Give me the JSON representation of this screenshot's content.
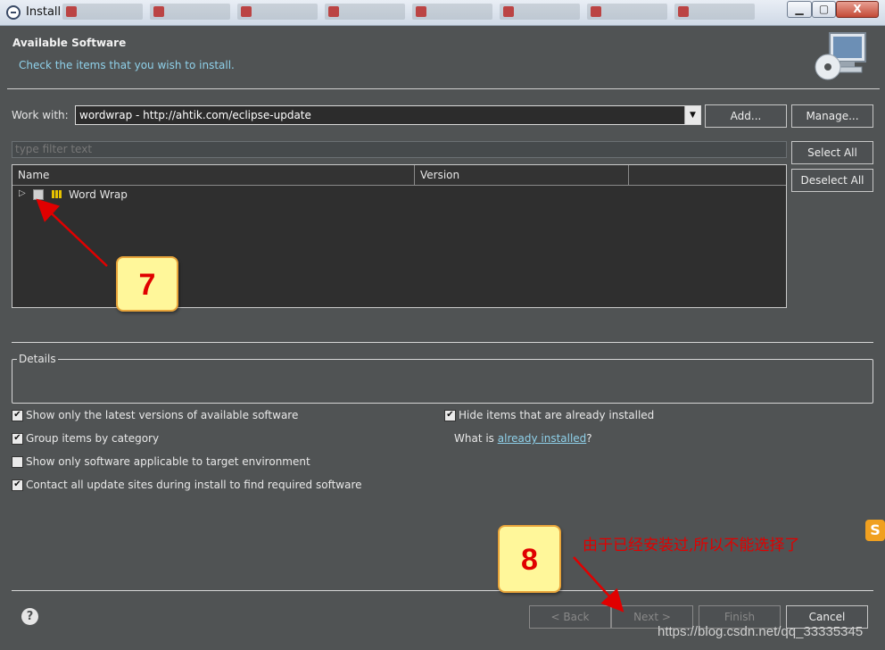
{
  "window": {
    "title": "Install",
    "min_label": "▁",
    "max_label": "▢",
    "close_label": "X"
  },
  "header": {
    "title": "Available Software",
    "description": "Check the items that you wish to install."
  },
  "work_with": {
    "label": "Work with:",
    "value": "wordwrap - http://ahtik.com/eclipse-update",
    "arrow": "▼",
    "add_label": "Add...",
    "manage_label": "Manage..."
  },
  "filter": {
    "placeholder": "type filter text"
  },
  "selection": {
    "select_all": "Select All",
    "deselect_all": "Deselect All"
  },
  "tree": {
    "columns": [
      "Name",
      "Version",
      ""
    ],
    "rows": [
      {
        "expander": "▷",
        "label": "Word Wrap",
        "checked": false
      }
    ]
  },
  "details": {
    "label": "Details"
  },
  "options": {
    "latest": {
      "label": "Show only the latest versions of available software",
      "checked": true
    },
    "group": {
      "label": "Group items by category",
      "checked": true
    },
    "target": {
      "label": "Show only software applicable to target environment",
      "checked": false
    },
    "contact": {
      "label": "Contact all update sites during install to find required software",
      "checked": true
    },
    "hide": {
      "label": "Hide items that are already installed",
      "checked": true
    },
    "whatis_prefix": "What is ",
    "whatis_link": "already installed",
    "whatis_suffix": "?"
  },
  "footer": {
    "help": "?",
    "back": "< Back",
    "next": "Next >",
    "finish": "Finish",
    "cancel": "Cancel"
  },
  "annotations": {
    "step7": "7",
    "step8": "8",
    "note": "由于已经安装过,所以不能选择了",
    "watermark": "https://blog.csdn.net/qq_33335345",
    "logo": "S",
    "arrow_color": "#e00000"
  }
}
